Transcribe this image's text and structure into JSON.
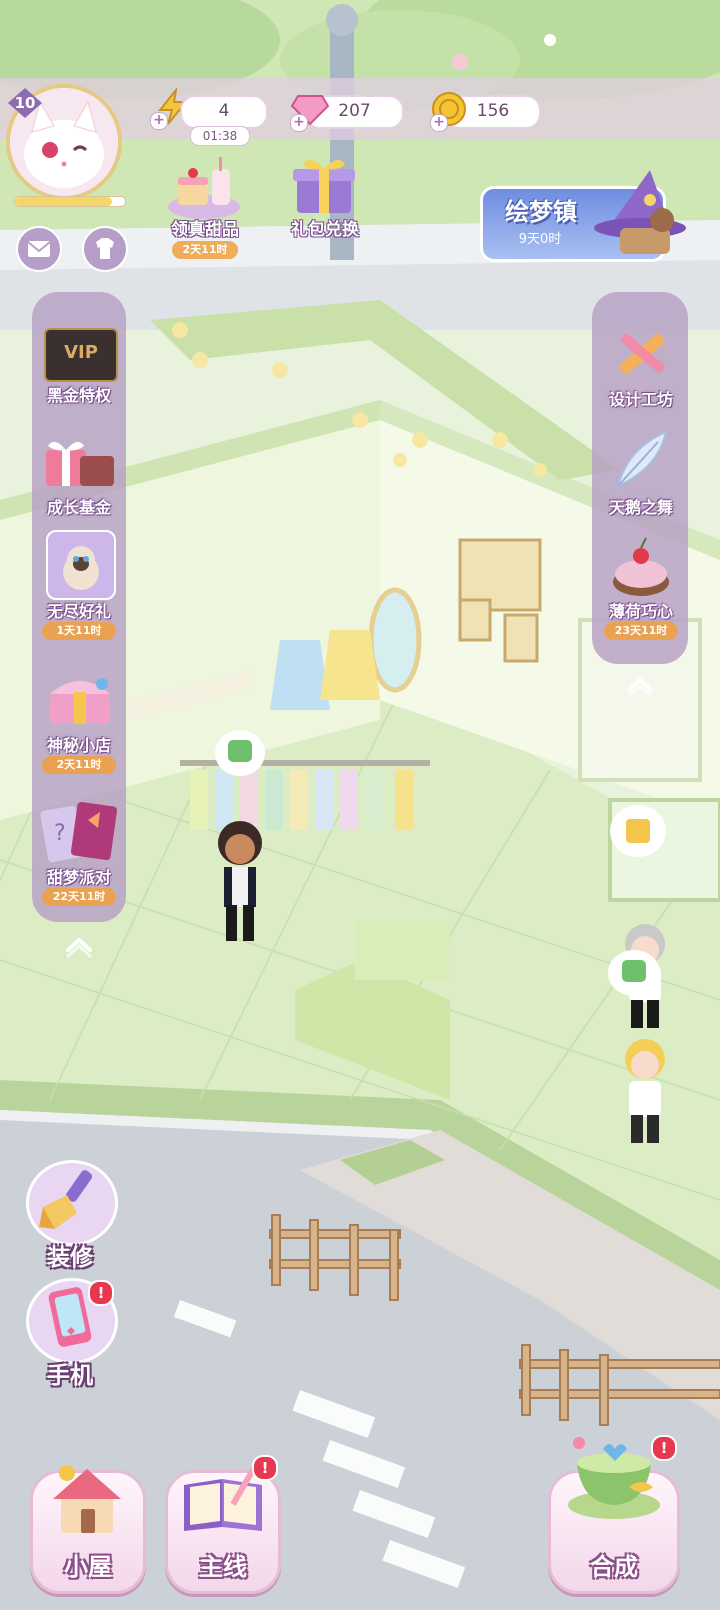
{
  "player": {
    "level": "10"
  },
  "resources": {
    "energy": "4",
    "energy_timer": "01:38",
    "gems": "207",
    "coins": "156"
  },
  "top_events": {
    "dessert_label": "领真甜品",
    "dessert_timer": "2天11时",
    "gift_label": "礼包兑换",
    "town_label": "绘梦镇",
    "town_timer": "9天0时"
  },
  "left_panel": {
    "items": [
      {
        "label": "黑金特权",
        "timer": ""
      },
      {
        "label": "成长基金",
        "timer": ""
      },
      {
        "label": "无尽好礼",
        "timer": "1天11时"
      },
      {
        "label": "神秘小店",
        "timer": "2天11时"
      },
      {
        "label": "甜梦派对",
        "timer": "22天11时"
      }
    ],
    "vip_text": "VIP"
  },
  "right_panel": {
    "items": [
      {
        "label": "设计工坊",
        "timer": ""
      },
      {
        "label": "天鹅之舞",
        "timer": ""
      },
      {
        "label": "薄荷巧心",
        "timer": "23天11时"
      }
    ]
  },
  "left_tools": {
    "decorate_label": "装修",
    "phone_label": "手机",
    "phone_badge": "!"
  },
  "bottom_nav": {
    "house_label": "小屋",
    "main_label": "主线",
    "main_badge": "!",
    "merge_label": "合成",
    "merge_badge": "!"
  },
  "colors": {
    "panel_purple": "#b7a0c4",
    "floor_green": "#dcedc6",
    "wall_green": "#eef6dd",
    "road_gray": "#c9cfd6",
    "timer_orange": "#f0a03c",
    "badge_red": "#e8384f"
  }
}
